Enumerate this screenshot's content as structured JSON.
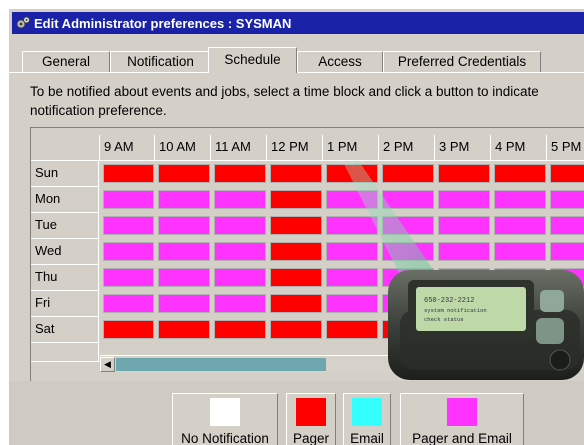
{
  "window": {
    "title": "Edit Administrator preferences : SYSMAN"
  },
  "tabs": [
    {
      "label": "General",
      "active": false
    },
    {
      "label": "Notification",
      "active": false
    },
    {
      "label": "Schedule",
      "active": true
    },
    {
      "label": "Access",
      "active": false
    },
    {
      "label": "Preferred Credentials",
      "active": false
    }
  ],
  "instructions": {
    "line1": "To be notified about events and jobs, select a time block and click a button to indicate",
    "line2": "notification preference."
  },
  "schedule": {
    "hours": [
      "9 AM",
      "10 AM",
      "11 AM",
      "12 PM",
      "1 PM",
      "2 PM",
      "3 PM",
      "4 PM",
      "5 PM"
    ],
    "days": [
      {
        "day": "Sun",
        "slots": [
          "pager",
          "pager",
          "pager",
          "pager",
          "pager",
          "pager",
          "pager",
          "pager",
          "pager"
        ]
      },
      {
        "day": "Mon",
        "slots": [
          "pager_email",
          "pager_email",
          "pager_email",
          "pager",
          "pager_email",
          "pager_email",
          "pager_email",
          "pager_email",
          "pager_email"
        ]
      },
      {
        "day": "Tue",
        "slots": [
          "pager_email",
          "pager_email",
          "pager_email",
          "pager",
          "pager_email",
          "pager_email",
          "pager_email",
          "pager_email",
          "pager_email"
        ]
      },
      {
        "day": "Wed",
        "slots": [
          "pager_email",
          "pager_email",
          "pager_email",
          "pager",
          "pager_email",
          "pager_email",
          "pager_email",
          "pager_email",
          "pager_email"
        ]
      },
      {
        "day": "Thu",
        "slots": [
          "pager_email",
          "pager_email",
          "pager_email",
          "pager",
          "pager_email",
          "pager_email",
          "pager_email",
          "pager_email",
          "pager_email"
        ]
      },
      {
        "day": "Fri",
        "slots": [
          "pager_email",
          "pager_email",
          "pager_email",
          "pager",
          "pager_email",
          "pager_email",
          "pager_email",
          "pager_email",
          "pager_email"
        ]
      },
      {
        "day": "Sat",
        "slots": [
          "pager",
          "pager",
          "pager",
          "pager",
          "pager",
          "pager",
          "pager",
          "pager",
          "pager"
        ]
      }
    ]
  },
  "legend": [
    {
      "key": "none",
      "label": "No Notification",
      "color": "#ffffff"
    },
    {
      "key": "pager",
      "label": "Pager",
      "color": "#ff0000"
    },
    {
      "key": "email",
      "label": "Email",
      "color": "#33ffff"
    },
    {
      "key": "pager_email",
      "label": "Pager and Email",
      "color": "#ff33ff"
    }
  ],
  "colors": {
    "titlebar": "#1a23a8",
    "dialog": "#d4d0c8",
    "pager": "#ff0000",
    "pager_email": "#ff33ff",
    "email": "#33ffff",
    "none": "#ffffff"
  },
  "pager_device": {
    "screen_lines": [
      "650-232-2212",
      "system notification",
      "check status"
    ]
  }
}
